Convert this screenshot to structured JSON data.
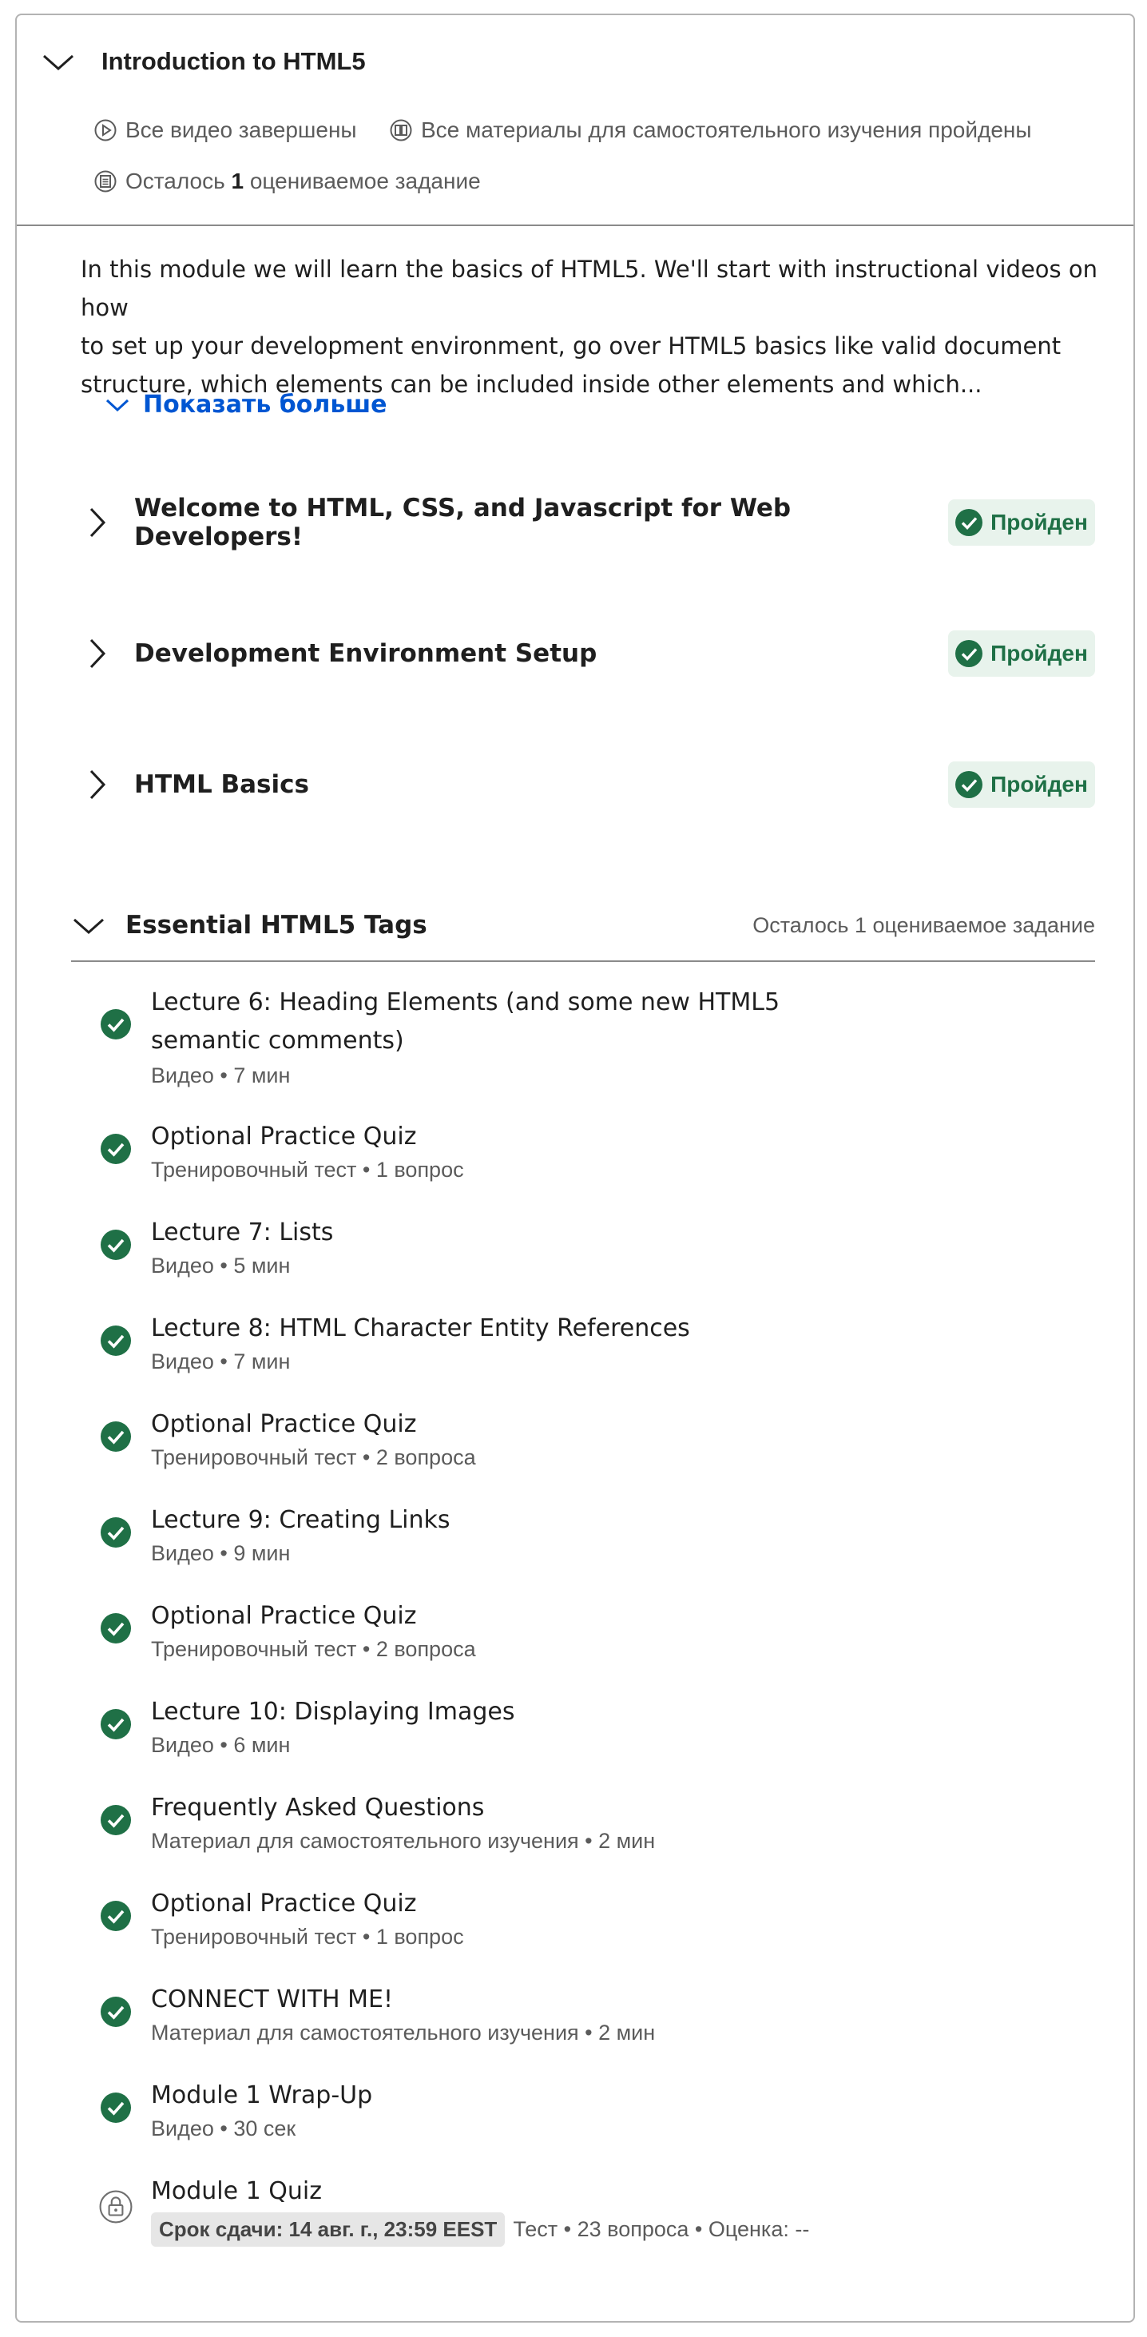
{
  "module": {
    "title": "Introduction to HTML5",
    "meta": {
      "videos": "Все видео завершены",
      "readings": "Все материалы для самостоятельного изучения пройдены",
      "graded_prefix": "Осталось",
      "graded_count": "1",
      "graded_suffix": "оцениваемое задание"
    },
    "description": [
      "In this module we will learn the basics of HTML5. We'll start with instructional videos on how",
      "to set up your development environment, go over HTML5 basics like valid document",
      "structure, which elements can be included inside other elements and which..."
    ],
    "show_more": "Показать больше"
  },
  "lessons": [
    {
      "title": "Welcome to HTML, CSS, and Javascript for Web Developers!",
      "status": "Пройден"
    },
    {
      "title": "Development Environment Setup",
      "status": "Пройден"
    },
    {
      "title": "HTML Basics",
      "status": "Пройден"
    }
  ],
  "open_lesson": {
    "title": "Essential HTML5 Tags",
    "remaining": "Осталось 1 оцениваемое задание"
  },
  "items": [
    {
      "name": "Lecture 6: Heading Elements (and some new HTML5 semantic comments)",
      "meta": "Видео • 7 мин"
    },
    {
      "name": "Optional Practice Quiz",
      "meta": "Тренировочный тест • 1 вопрос"
    },
    {
      "name": "Lecture 7: Lists",
      "meta": "Видео • 5 мин"
    },
    {
      "name": "Lecture 8: HTML Character Entity References",
      "meta": "Видео • 7 мин"
    },
    {
      "name": "Optional Practice Quiz",
      "meta": "Тренировочный тест • 2 вопроса"
    },
    {
      "name": "Lecture 9: Creating Links",
      "meta": "Видео • 9 мин"
    },
    {
      "name": "Optional Practice Quiz",
      "meta": "Тренировочный тест • 2 вопроса"
    },
    {
      "name": "Lecture 10: Displaying Images",
      "meta": "Видео • 6 мин"
    },
    {
      "name": "Frequently Asked Questions",
      "meta": "Материал для самостоятельного изучения • 2 мин"
    },
    {
      "name": "Optional Practice Quiz",
      "meta": "Тренировочный тест • 1 вопрос"
    },
    {
      "name": "CONNECT WITH ME!",
      "meta": "Материал для самостоятельного изучения • 2 мин"
    },
    {
      "name": "Module 1 Wrap-Up",
      "meta": "Видео • 30 сек"
    },
    {
      "name": "Module 1 Quiz",
      "due": "Срок сдачи: 14 авг. г., 23:59 EEST",
      "meta": "Тест • 23 вопроса • Оценка: --"
    }
  ],
  "colors": {
    "accent": "#0056d2",
    "success": "#1f7046",
    "success_bg": "#e8f3ec",
    "muted": "#5b5b5b"
  },
  "icons": {
    "module_toggle": "chevron-down-icon",
    "lesson_toggle": "chevron-right-icon",
    "completed": "check-circle-icon",
    "locked": "lock-icon"
  }
}
